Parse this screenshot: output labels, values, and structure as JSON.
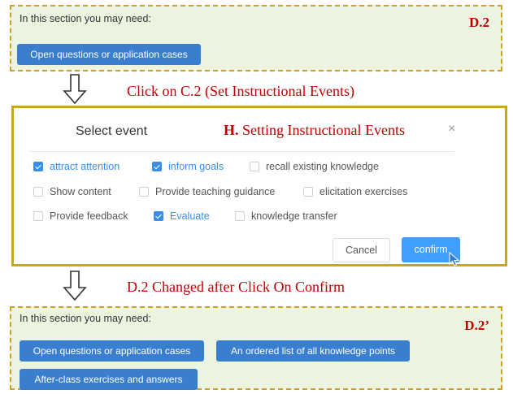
{
  "top_panel": {
    "hint": "In this section you may need:",
    "tag": "D.2",
    "buttons": [
      "Open questions or application cases"
    ]
  },
  "caption_1": "Click on C.2 (Set Instructional Events)",
  "dialog": {
    "title": "Select event",
    "heading_bold": "H.",
    "heading_rest": " Setting Instructional Events",
    "close": "×",
    "options": [
      {
        "label": "attract attention",
        "checked": true
      },
      {
        "label": "inform goals",
        "checked": true
      },
      {
        "label": "recall existing knowledge",
        "checked": false
      },
      {
        "label": "Show content",
        "checked": false
      },
      {
        "label": "Provide teaching guidance",
        "checked": false
      },
      {
        "label": "elicitation exercises",
        "checked": false
      },
      {
        "label": "Provide feedback",
        "checked": false
      },
      {
        "label": "Evaluate",
        "checked": true
      },
      {
        "label": "knowledge transfer",
        "checked": false
      }
    ],
    "cancel": "Cancel",
    "confirm": "confirm"
  },
  "caption_2": "D.2 Changed after Click On Confirm",
  "bottom_panel": {
    "hint": "In this section you may need:",
    "tag": "D.2’",
    "buttons": [
      "Open questions or application cases",
      "An ordered list of all knowledge points",
      "After-class exercises and answers"
    ]
  },
  "colors": {
    "panel_bg": "#ebf4df",
    "panel_border": "#c9a227",
    "annotation_red": "#c00000",
    "button_blue": "#3a7fcf",
    "checkbox_blue": "#409eff"
  }
}
